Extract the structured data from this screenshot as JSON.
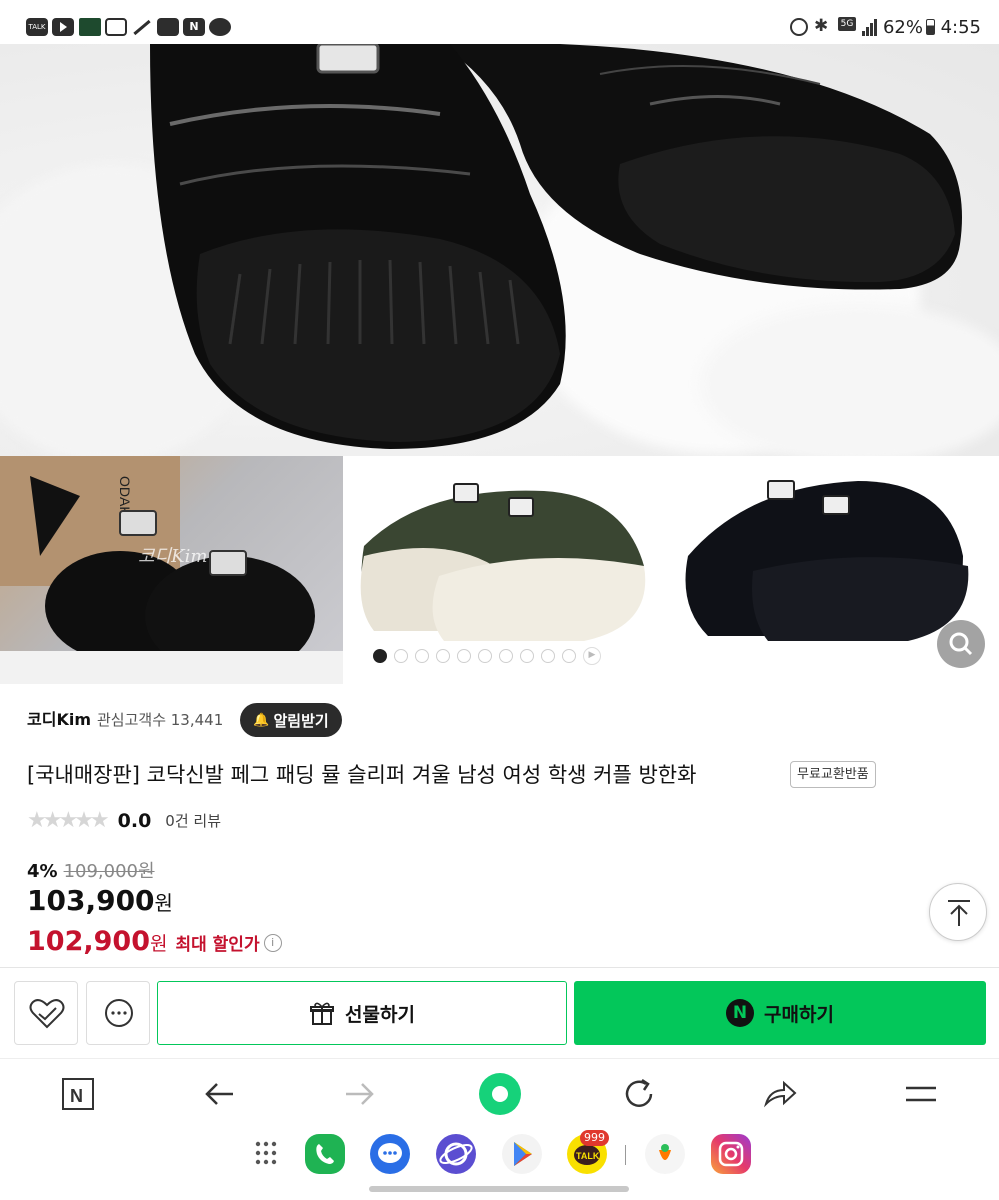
{
  "status_bar": {
    "battery": "62%",
    "time": "4:55",
    "left_icons": [
      "kakaotalk-icon",
      "youtube-icon",
      "app-icon",
      "voicemail-icon",
      "signal-app-icon",
      "gallery-icon",
      "naver-icon",
      "talk-bubble-icon"
    ],
    "right_icons": [
      "alarm-icon",
      "bluetooth-icon",
      "5g-icon",
      "signal-icon",
      "battery-icon"
    ]
  },
  "gallery": {
    "thumb_watermark": "코디Kim",
    "dots_total": 10,
    "active_dot": 1
  },
  "seller": {
    "name": "코디Kim",
    "fans_label": "관심고객수 13,441",
    "alarm_label": "알림받기"
  },
  "product": {
    "title": "[국내매장판] 코닥신발 페그 패딩 뮬 슬리퍼 겨울 남성 여성 학생 커플 방한화",
    "badge": "무료교환반품",
    "rating": "0.0",
    "review_label": "0건 리뷰",
    "discount_pct": "4%",
    "original_price": "109,000원",
    "price": "103,900",
    "price_unit": "원",
    "max_price": "102,900",
    "max_price_unit": "원",
    "max_price_label": "최대 할인가"
  },
  "actions": {
    "gift_label": "선물하기",
    "buy_label": "구매하기",
    "buy_badge": "N"
  },
  "colors": {
    "naver_green": "#03c75a",
    "sale_red": "#c4122e"
  },
  "dock_apps": [
    "apps-grid-icon",
    "phone-icon",
    "messages-icon",
    "internet-icon",
    "play-store-icon",
    "kakaotalk-icon",
    "carrot-icon",
    "instagram-icon"
  ],
  "dock_badge": "999"
}
